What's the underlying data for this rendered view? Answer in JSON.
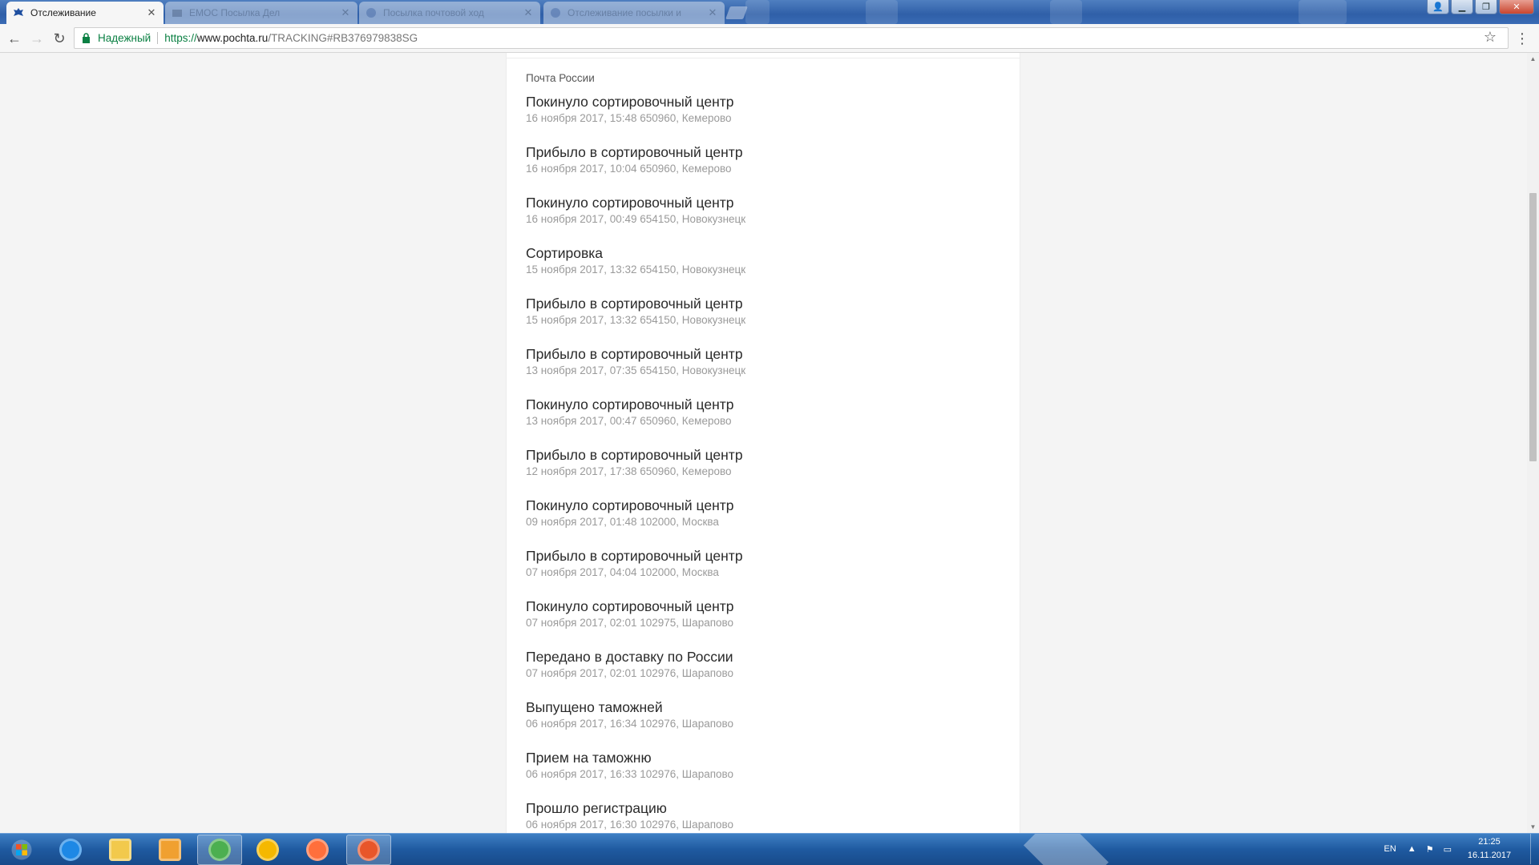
{
  "browser": {
    "active_tab": {
      "title": "Отслеживание",
      "icon": "pochta-eagle-icon"
    },
    "inactive_tabs": [
      {
        "title": "ЕМОС Посылка Дел",
        "icon": "generic-tab-icon"
      },
      {
        "title": "Посылка почтовой ход",
        "icon": "globe-icon"
      },
      {
        "title": "Отслеживание посылки и",
        "icon": "globe-icon"
      }
    ],
    "security_label": "Надежный",
    "url_scheme": "https://",
    "url_host": "www.pochta.ru",
    "url_path": "/TRACKING#RB376979838SG"
  },
  "tracking": {
    "carrier": "Почта России",
    "events": [
      {
        "title": "Покинуло сортировочный центр",
        "meta": "16 ноября 2017, 15:48 650960, Кемерово"
      },
      {
        "title": "Прибыло в сортировочный центр",
        "meta": "16 ноября 2017, 10:04 650960, Кемерово"
      },
      {
        "title": "Покинуло сортировочный центр",
        "meta": "16 ноября 2017, 00:49 654150, Новокузнецк"
      },
      {
        "title": "Сортировка",
        "meta": "15 ноября 2017, 13:32 654150, Новокузнецк"
      },
      {
        "title": "Прибыло в сортировочный центр",
        "meta": "15 ноября 2017, 13:32 654150, Новокузнецк"
      },
      {
        "title": "Прибыло в сортировочный центр",
        "meta": "13 ноября 2017, 07:35 654150, Новокузнецк"
      },
      {
        "title": "Покинуло сортировочный центр",
        "meta": "13 ноября 2017, 00:47 650960, Кемерово"
      },
      {
        "title": "Прибыло в сортировочный центр",
        "meta": "12 ноября 2017, 17:38 650960, Кемерово"
      },
      {
        "title": "Покинуло сортировочный центр",
        "meta": "09 ноября 2017, 01:48 102000, Москва"
      },
      {
        "title": "Прибыло в сортировочный центр",
        "meta": "07 ноября 2017, 04:04 102000, Москва"
      },
      {
        "title": "Покинуло сортировочный центр",
        "meta": "07 ноября 2017, 02:01 102975, Шарапово"
      },
      {
        "title": "Передано в доставку по России",
        "meta": "07 ноября 2017, 02:01 102976, Шарапово"
      },
      {
        "title": "Выпущено таможней",
        "meta": "06 ноября 2017, 16:34 102976, Шарапово"
      },
      {
        "title": "Прием на таможню",
        "meta": "06 ноября 2017, 16:33 102976, Шарапово"
      },
      {
        "title": "Прошло регистрацию",
        "meta": "06 ноября 2017, 16:30 102976, Шарапово"
      }
    ]
  },
  "taskbar": {
    "apps": [
      {
        "name": "internet-explorer-icon",
        "color": "#1e88e5"
      },
      {
        "name": "file-explorer-icon",
        "color": "#f2c94c"
      },
      {
        "name": "media-player-icon",
        "color": "#f0a030"
      },
      {
        "name": "chrome-icon",
        "color": "#4caf50"
      },
      {
        "name": "aimp-icon",
        "color": "#f5b800"
      },
      {
        "name": "media-center-icon",
        "color": "#ff6f3c"
      },
      {
        "name": "firefox-icon",
        "color": "#e8562a"
      }
    ],
    "language": "EN",
    "time": "21:25",
    "date": "16.11.2017"
  }
}
